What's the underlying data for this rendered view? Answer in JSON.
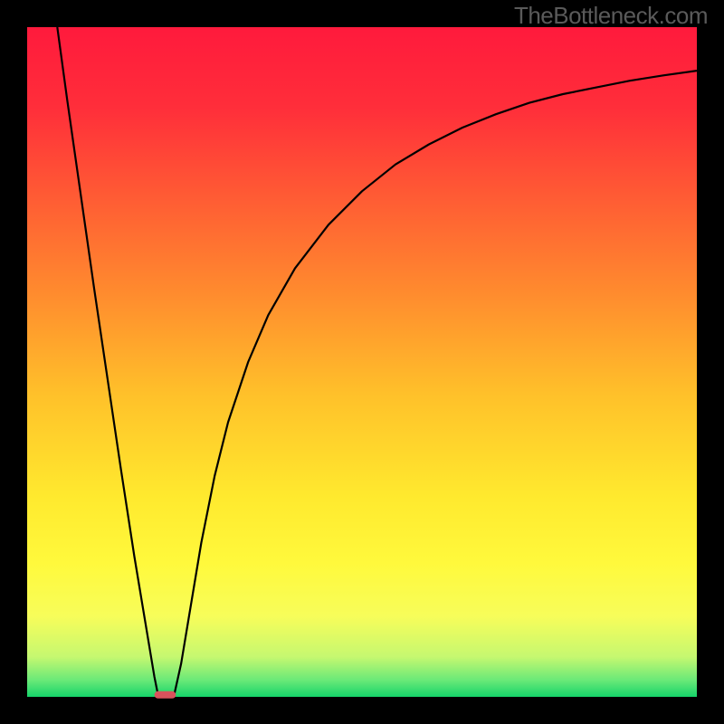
{
  "watermark": "TheBottleneck.com",
  "chart_data": {
    "type": "line",
    "title": "",
    "xlabel": "",
    "ylabel": "",
    "xlim": [
      0,
      100
    ],
    "ylim": [
      0,
      100
    ],
    "grid": false,
    "curve": [
      {
        "x": 4.5,
        "y": 100.0
      },
      {
        "x": 6.0,
        "y": 89.0
      },
      {
        "x": 8.0,
        "y": 75.0
      },
      {
        "x": 10.0,
        "y": 61.0
      },
      {
        "x": 12.0,
        "y": 47.5
      },
      {
        "x": 14.0,
        "y": 34.0
      },
      {
        "x": 16.0,
        "y": 21.0
      },
      {
        "x": 18.0,
        "y": 9.0
      },
      {
        "x": 19.0,
        "y": 3.0
      },
      {
        "x": 19.5,
        "y": 0.5
      },
      {
        "x": 19.8,
        "y": 0.0
      },
      {
        "x": 21.5,
        "y": 0.0
      },
      {
        "x": 22.0,
        "y": 0.5
      },
      {
        "x": 23.0,
        "y": 5.0
      },
      {
        "x": 24.0,
        "y": 11.0
      },
      {
        "x": 26.0,
        "y": 23.0
      },
      {
        "x": 28.0,
        "y": 33.0
      },
      {
        "x": 30.0,
        "y": 41.0
      },
      {
        "x": 33.0,
        "y": 50.0
      },
      {
        "x": 36.0,
        "y": 57.0
      },
      {
        "x": 40.0,
        "y": 64.0
      },
      {
        "x": 45.0,
        "y": 70.5
      },
      {
        "x": 50.0,
        "y": 75.5
      },
      {
        "x": 55.0,
        "y": 79.5
      },
      {
        "x": 60.0,
        "y": 82.5
      },
      {
        "x": 65.0,
        "y": 85.0
      },
      {
        "x": 70.0,
        "y": 87.0
      },
      {
        "x": 75.0,
        "y": 88.7
      },
      {
        "x": 80.0,
        "y": 90.0
      },
      {
        "x": 85.0,
        "y": 91.0
      },
      {
        "x": 90.0,
        "y": 92.0
      },
      {
        "x": 95.0,
        "y": 92.8
      },
      {
        "x": 100.0,
        "y": 93.5
      }
    ],
    "marker_bottom": {
      "x_center": 20.6,
      "x_halfwidth": 1.6,
      "y": 0.3
    },
    "gradient_stops": [
      {
        "offset": 0.0,
        "color": "#ff1a3c"
      },
      {
        "offset": 0.12,
        "color": "#ff2e3a"
      },
      {
        "offset": 0.25,
        "color": "#ff5a34"
      },
      {
        "offset": 0.4,
        "color": "#ff8c2e"
      },
      {
        "offset": 0.55,
        "color": "#ffc12a"
      },
      {
        "offset": 0.7,
        "color": "#ffe92e"
      },
      {
        "offset": 0.8,
        "color": "#fff93c"
      },
      {
        "offset": 0.88,
        "color": "#f7fd5a"
      },
      {
        "offset": 0.94,
        "color": "#c6f870"
      },
      {
        "offset": 0.975,
        "color": "#6ae978"
      },
      {
        "offset": 1.0,
        "color": "#16d46a"
      }
    ],
    "frame": {
      "outer_w": 800,
      "outer_h": 800,
      "inner_left": 30,
      "inner_top": 30,
      "inner_w": 740,
      "inner_h": 740,
      "border_color": "#000000"
    }
  }
}
